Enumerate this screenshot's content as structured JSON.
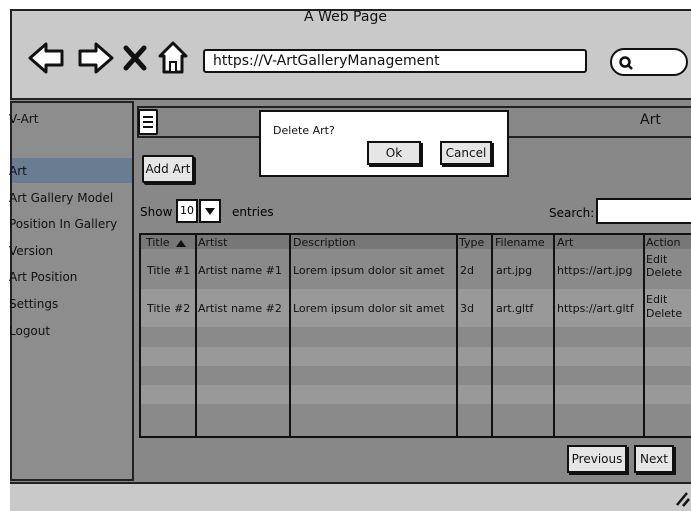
{
  "browser": {
    "title": "A Web Page",
    "url": "https://V-ArtGalleryManagement"
  },
  "sidebar": {
    "brand": "V-Art",
    "items": [
      {
        "label": "Art"
      },
      {
        "label": "Art Gallery Model"
      },
      {
        "label": "Position In Gallery"
      },
      {
        "label": "Version"
      },
      {
        "label": "Art Position"
      },
      {
        "label": "Settings"
      },
      {
        "label": "Logout"
      }
    ],
    "active_index": 0
  },
  "header": {
    "page_title": "Art"
  },
  "toolbar": {
    "add_label": "Add Art",
    "show_label": "Show",
    "entries_value": "10",
    "entries_label": "entries",
    "search_label": "Search:"
  },
  "table": {
    "columns": [
      "Title",
      "Artist",
      "Description",
      "Type",
      "Filename",
      "Art",
      "Action"
    ],
    "rows": [
      {
        "title": "Title #1",
        "artist": "Artist name #1",
        "description": "Lorem ipsum dolor sit amet",
        "type": "2d",
        "filename": "art.jpg",
        "art": "https://art.jpg",
        "edit": "Edit",
        "delete": "Delete"
      },
      {
        "title": "Title #2",
        "artist": "Artist name #2",
        "description": "Lorem ipsum dolor sit amet",
        "type": "3d",
        "filename": "art.gltf",
        "art": "https://art.gltf",
        "edit": "Edit",
        "delete": "Delete"
      }
    ]
  },
  "pagination": {
    "previous": "Previous",
    "next": "Next"
  },
  "modal": {
    "title": "Delete Art?",
    "ok": "Ok",
    "cancel": "Cancel"
  }
}
